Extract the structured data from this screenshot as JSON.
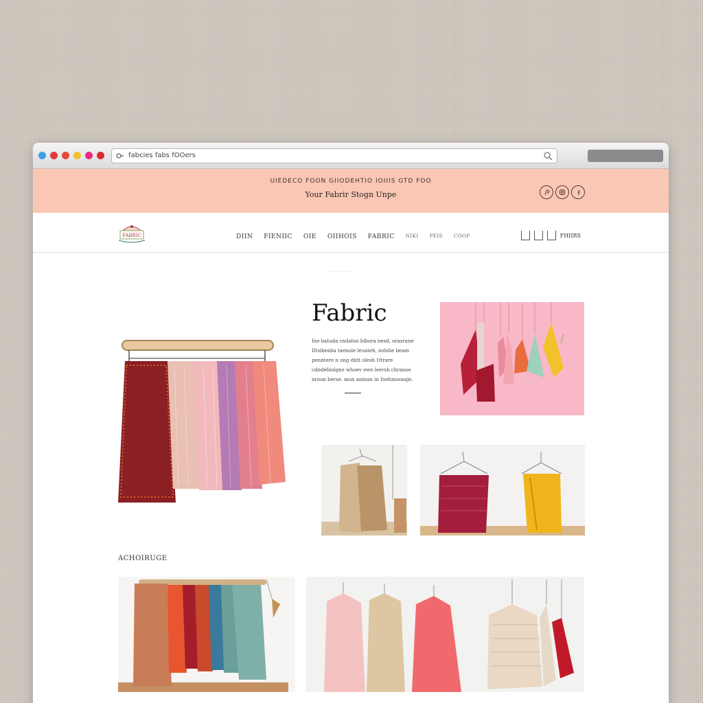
{
  "browser": {
    "url": "fabcies fabs fOOers",
    "dot_colors": [
      "#3aa0e8",
      "#e23b3b",
      "#e8473a",
      "#f2c12e",
      "#e9297f",
      "#d92c2c"
    ]
  },
  "promo": {
    "headline": "UIEDECO FOON GIIODEHTIO IOIIIS GTD FOO",
    "tagline": "Your Fabrir Stogn Unpe",
    "social_icons": [
      "pinterest-icon",
      "instagram-icon",
      "facebook-icon"
    ]
  },
  "nav": {
    "logo_text": "FABRIC",
    "links": [
      "DIIN",
      "FIENIIC",
      "OIE",
      "OIIHOIS",
      "FABRIC",
      "NIKI",
      "PEIS",
      "COOP"
    ],
    "account_label": "FHIIRS"
  },
  "hero": {
    "breadcrumb": "- - - - - - -",
    "title": "Fabric",
    "body": "Ine batuda cndaluo bibora nesd, orasrane IItsibeaba taenoie leunieh, nolsbe beam penntere n ung dntt olesh Otrare cdndebiolgne whoev ewe leersh chranoe nroon berse. mon aninan in Inehmoosaje."
  },
  "section": {
    "label": "ACHOIRUGE"
  },
  "colors": {
    "promo_bg": "#fbc7b5",
    "hero_pink_panel": "#f8b8c8",
    "page_bg": "#ffffff"
  }
}
